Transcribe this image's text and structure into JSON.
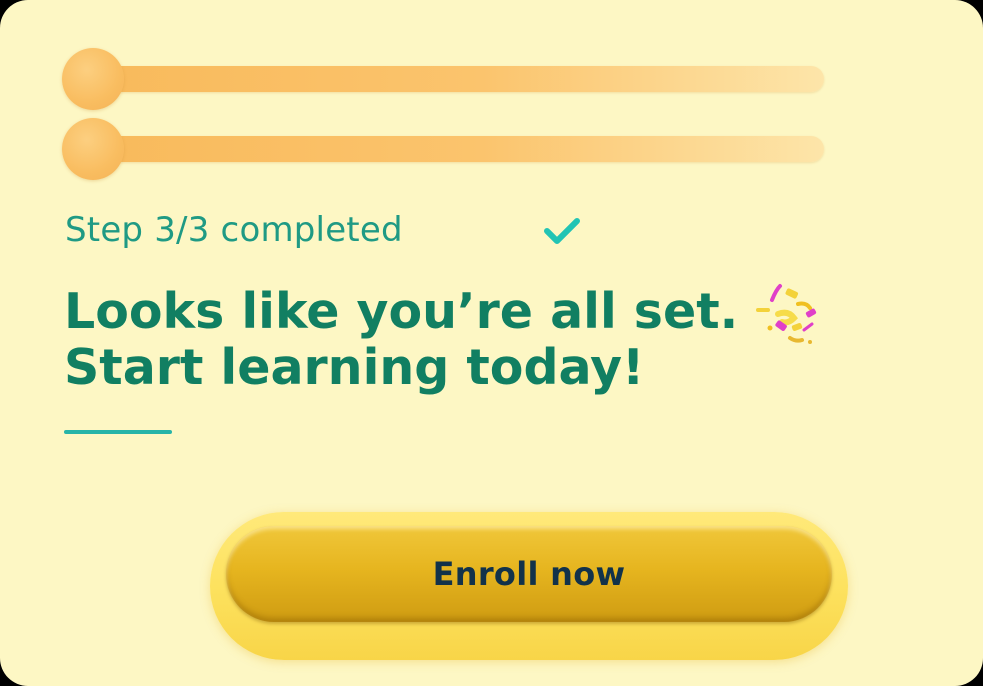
{
  "progress": {
    "step_text": "Step 3/3 completed",
    "slider_1_value": 1.0,
    "slider_2_value": 1.0
  },
  "headline": {
    "line_1": "Looks like you’re all set.",
    "line_2": "Start learning today!"
  },
  "icons": {
    "check": "check-icon",
    "confetti": "confetti-icon"
  },
  "cta": {
    "enroll_label": "Enroll now"
  },
  "colors": {
    "background": "#fdf7c4",
    "accent_teal": "#1f9a84",
    "headline_green": "#117f62",
    "slider_orange": "#f8b95a",
    "button_gold": "#e6b51f",
    "button_text": "#12324a"
  }
}
